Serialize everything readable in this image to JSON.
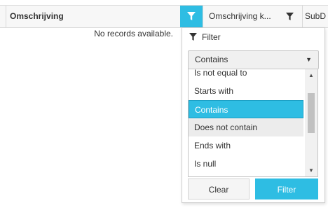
{
  "header": {
    "col_omschrijving": "Omschrijving",
    "col_omschrijving_k": "Omschrijving k...",
    "col_subd": "SubD"
  },
  "grid": {
    "empty_message": "No records available."
  },
  "filter_popup": {
    "title": "Filter",
    "operator_selected": "Contains",
    "operators": [
      {
        "label": "Is not equal to",
        "state": "normal"
      },
      {
        "label": "Starts with",
        "state": "normal"
      },
      {
        "label": "Contains",
        "state": "selected"
      },
      {
        "label": "Does not contain",
        "state": "hover"
      },
      {
        "label": "Ends with",
        "state": "normal"
      },
      {
        "label": "Is null",
        "state": "normal"
      }
    ],
    "clear_label": "Clear",
    "filter_label": "Filter"
  },
  "colors": {
    "accent": "#2ebde3",
    "header_bg": "#f7f7f7",
    "border": "#dadada"
  },
  "icons": {
    "active_filter": "filter-icon",
    "column_filter": "filter-icon",
    "popup_title": "filter-icon",
    "dropdown": "caret-down-icon"
  }
}
